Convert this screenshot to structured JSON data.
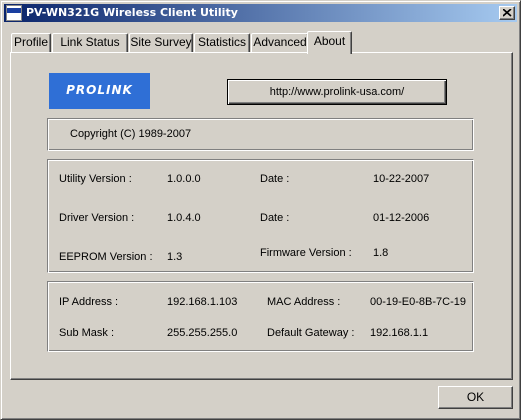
{
  "window": {
    "title": "PV-WN321G Wireless Client Utility",
    "app_icon_text": "PROLINK"
  },
  "tabs": [
    {
      "label": "Profile"
    },
    {
      "label": "Link Status"
    },
    {
      "label": "Site Survey"
    },
    {
      "label": "Statistics"
    },
    {
      "label": "Advanced"
    },
    {
      "label": "About",
      "active": true
    }
  ],
  "about": {
    "logo_text": "PROLINK",
    "url_button": "http://www.prolink-usa.com/",
    "copyright": "Copyright (C) 1989-2007",
    "versions": {
      "utility_label": "Utility Version :",
      "utility_value": "1.0.0.0",
      "utility_date_label": "Date :",
      "utility_date_value": "10-22-2007",
      "driver_label": "Driver Version :",
      "driver_value": "1.0.4.0",
      "driver_date_label": "Date :",
      "driver_date_value": "01-12-2006",
      "eeprom_label": "EEPROM Version :",
      "eeprom_value": "1.3",
      "firmware_label": "Firmware Version :",
      "firmware_value": "1.8"
    },
    "network": {
      "ip_label": "IP Address :",
      "ip_value": "192.168.1.103",
      "mac_label": "MAC Address :",
      "mac_value": "00-19-E0-8B-7C-19",
      "mask_label": "Sub Mask :",
      "mask_value": "255.255.255.0",
      "gateway_label": "Default Gateway :",
      "gateway_value": "192.168.1.1"
    }
  },
  "buttons": {
    "ok": "OK"
  }
}
